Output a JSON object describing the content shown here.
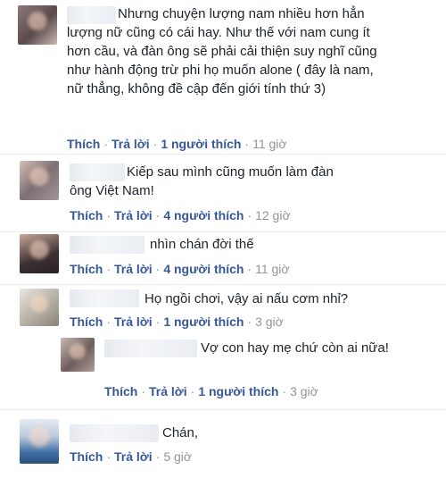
{
  "comments": [
    {
      "text": "Nhưng chuyện lượng nam nhiều hơn hẳn lượng nữ cũng có cái hay. Như thế với nam cung ít hơn cầu, và đàn ông sẽ phải cải thiện suy nghĩ cũng như hành động trừ phi họ muốn alone ( đây là nam, nữ thẳng, không đề cập đến giới tính thứ 3)",
      "like": "Thích",
      "reply": "Trả lời",
      "likes": "1 người thích",
      "time": "11 giờ"
    },
    {
      "text": "Kiếp sau mình cũng muốn làm đàn ông Việt Nam!",
      "like": "Thích",
      "reply": "Trả lời",
      "likes": "4 người thích",
      "time": "12 giờ"
    },
    {
      "text": "nhìn chán đời thế",
      "like": "Thích",
      "reply": "Trả lời",
      "likes": "4 người thích",
      "time": "11 giờ"
    },
    {
      "text": "Họ ngồi chơi, vậy ai nấu cơm nhỉ?",
      "like": "Thích",
      "reply": "Trả lời",
      "likes": "1 người thích",
      "time": "3 giờ"
    },
    {
      "text": "Vợ con hay mẹ chứ còn ai nữa!",
      "like": "Thích",
      "reply": "Trả lời",
      "likes": "1 người thích",
      "time": "3 giờ"
    },
    {
      "text": "Chán,",
      "like": "Thích",
      "reply": "Trả lời",
      "time": "5 giờ"
    }
  ],
  "separator": "·"
}
